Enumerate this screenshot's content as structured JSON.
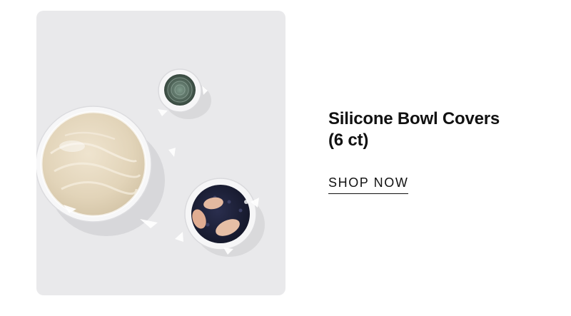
{
  "product": {
    "title_line1": "Silicone Bowl Covers",
    "title_line2": "(6 ct)",
    "cta_label": "SHOP NOW"
  },
  "colors": {
    "image_background": "#e9e9eb",
    "text": "#111111"
  }
}
